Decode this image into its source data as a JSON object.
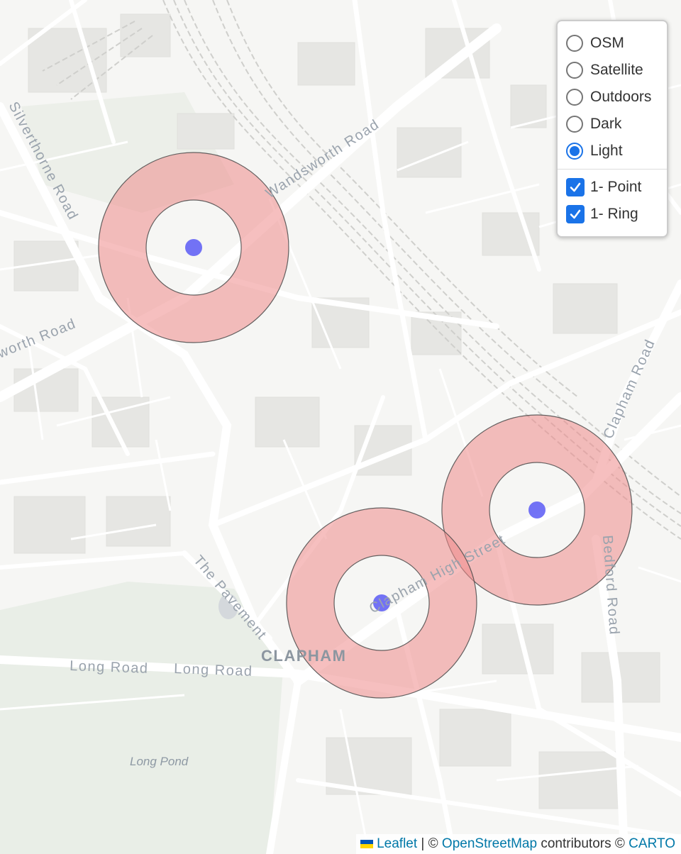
{
  "map": {
    "street_labels": {
      "wandsworth_road": "Wandsworth Road",
      "silverthorne_road": "Silverthorne Road",
      "worth_road": "worth Road",
      "clapham_road": "Clapham Road",
      "bedford_road": "Bedford Road",
      "clapham_high_street": "Clapham High Street",
      "the_pavement": "The Pavement",
      "long_road_1": "Long Road",
      "long_road_2": "Long Road"
    },
    "place_labels": {
      "clapham": "CLAPHAM",
      "long_pond": "Long Pond"
    },
    "colors": {
      "ring_fill": "#ef8a8a",
      "ring_stroke": "#4a4a4a",
      "point": "#5b5bf5",
      "background": "#f6f6f4",
      "road": "#ffffff",
      "park": "#e8ede6"
    },
    "markers": [
      "point-1",
      "point-2",
      "point-3"
    ],
    "rings": [
      "ring-1",
      "ring-2",
      "ring-3"
    ]
  },
  "layer_control": {
    "base_layers": [
      {
        "label": "OSM",
        "checked": false
      },
      {
        "label": "Satellite",
        "checked": false
      },
      {
        "label": "Outdoors",
        "checked": false
      },
      {
        "label": "Dark",
        "checked": false
      },
      {
        "label": "Light",
        "checked": true
      }
    ],
    "overlays": [
      {
        "label": "1- Point",
        "checked": true
      },
      {
        "label": "1- Ring",
        "checked": true
      }
    ]
  },
  "attribution": {
    "leaflet": "Leaflet",
    "sep1": " | © ",
    "osm": "OpenStreetMap",
    "contrib": " contributors © ",
    "carto": "CARTO",
    "flag_colors": [
      "#0057b7",
      "#ffd700"
    ]
  }
}
